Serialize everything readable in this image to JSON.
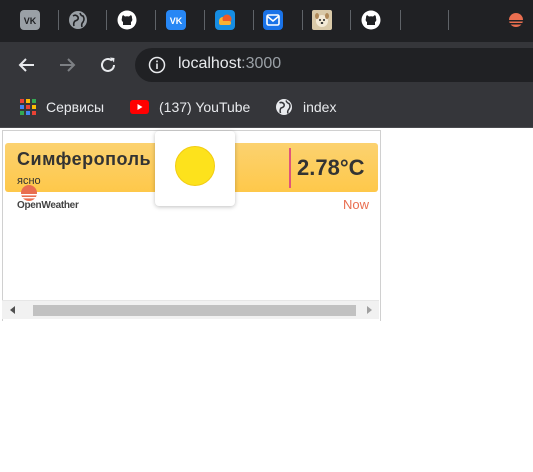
{
  "tabstrip": {
    "tabs": [
      {
        "icon": "vk-icon",
        "color": "#9aa0a6"
      },
      {
        "icon": "globe-icon",
        "color": "#9aa0a6"
      },
      {
        "icon": "github-icon",
        "color": "#ffffff"
      },
      {
        "icon": "vk-icon",
        "color": "#2787f5"
      },
      {
        "icon": "cloud-icon",
        "color": "#168de2"
      },
      {
        "icon": "mail-icon",
        "color": "#1a73e8"
      },
      {
        "icon": "dog-photo-icon",
        "color": "#d9c9a8"
      },
      {
        "icon": "github-icon",
        "color": "#ffffff"
      },
      {
        "icon": "openweather-icon",
        "color": "#e96e50"
      }
    ]
  },
  "toolbar": {
    "back": "back-arrow-icon",
    "forward": "forward-arrow-icon",
    "reload": "reload-icon",
    "url_host": "localhost",
    "url_port": ":3000"
  },
  "bookmarks": [
    {
      "icon": "apps-grid-icon",
      "label": "Сервисы"
    },
    {
      "icon": "youtube-icon",
      "label": "(137) YouTube"
    },
    {
      "icon": "globe-icon",
      "label": "index"
    }
  ],
  "weather": {
    "city": "Симферополь",
    "condition": "ясно",
    "temperature": "2.78°C",
    "icon": "sun-icon",
    "provider": "OpenWeather",
    "time_label": "Now",
    "colors": {
      "bar": "#fec84a",
      "divider": "#e0557a",
      "now": "#e96e50",
      "sun": "#fde21c"
    }
  }
}
